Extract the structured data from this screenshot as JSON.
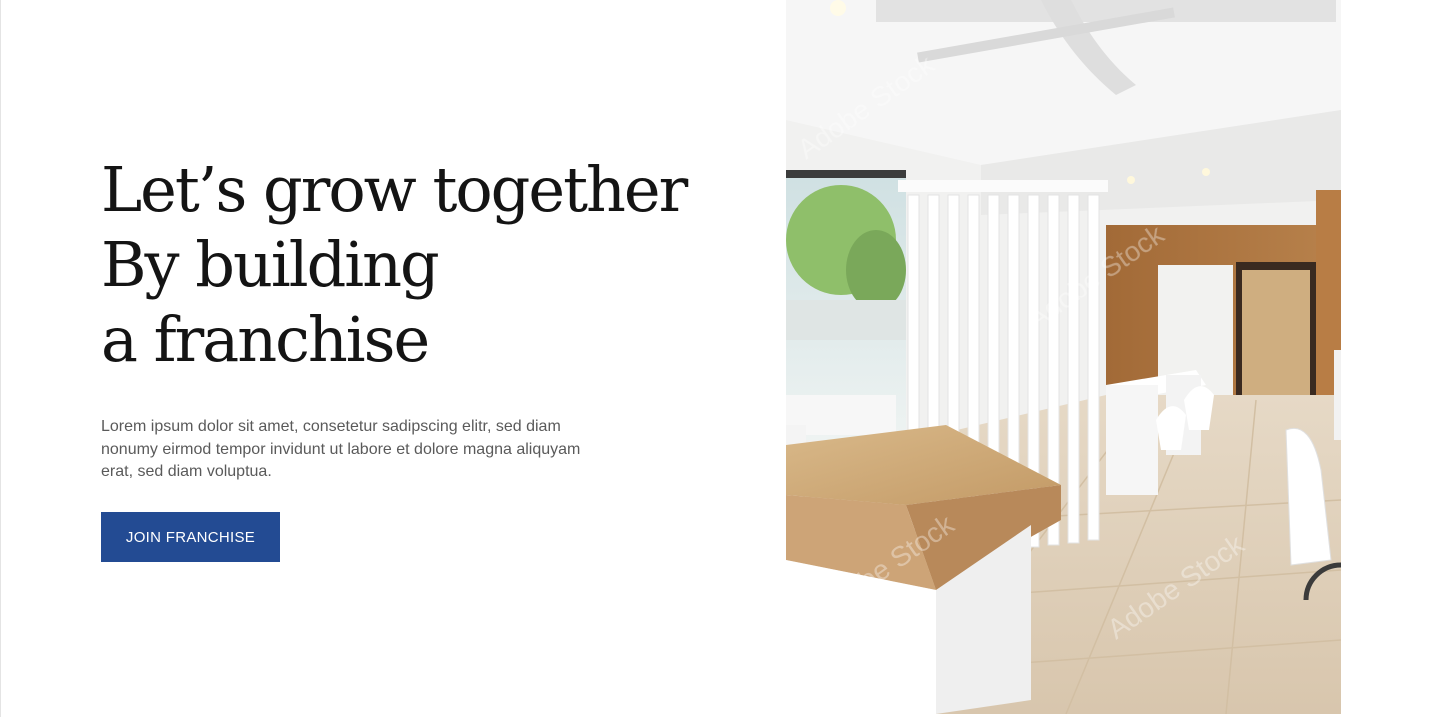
{
  "hero": {
    "headline_lines": [
      "Let’s grow together",
      "By building",
      "a franchise"
    ],
    "body": "Lorem ipsum dolor sit amet, consetetur sadipscing elitr, sed diam nonumy eirmod tempor invidunt ut labore et dolore magna aliquyam erat, sed diam voluptua.",
    "cta_label": "JOIN FRANCHISE"
  },
  "colors": {
    "accent": "#234b93",
    "headline": "#141414",
    "body_text": "#5a5a5a",
    "background": "#ffffff"
  },
  "image": {
    "subject": "salon-interior-photo",
    "watermark": "Adobe Stock"
  }
}
